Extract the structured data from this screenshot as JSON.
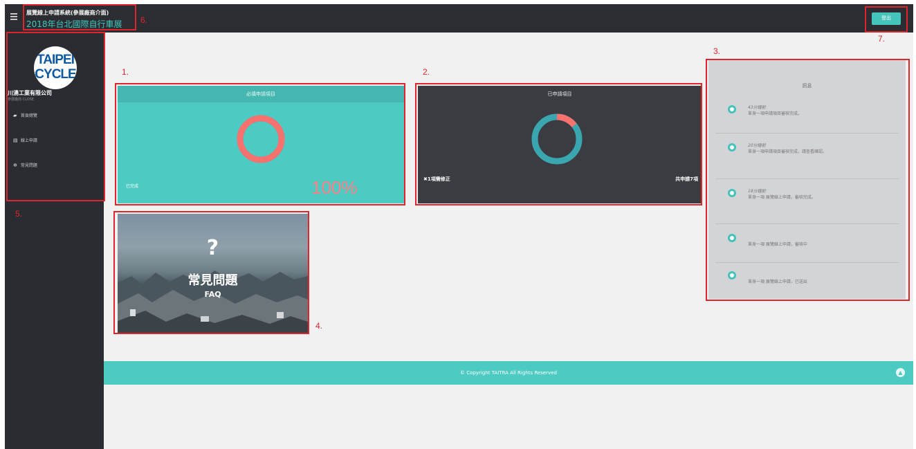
{
  "header": {
    "app_title": "展覽線上申請系統(參展廠商介面)",
    "exhibition": "2018年台北國際自行車展",
    "logout_label": "登出"
  },
  "sidebar": {
    "logo_line1": "TAIPEI",
    "logo_line2": "CYCLE",
    "company": "川湧工業有限公司",
    "company_sub": "參展廠商 CLOSE",
    "items": [
      {
        "label": "首頁總覽",
        "icon": "dashboard-icon"
      },
      {
        "label": "線上申請",
        "icon": "form-icon"
      },
      {
        "label": "常見問題",
        "icon": "gear-icon"
      }
    ]
  },
  "cards": {
    "required": {
      "title": "必填申請項目",
      "status": "已完成",
      "percent": "100%",
      "progress_fraction": 1.0
    },
    "applied": {
      "title": "已申請項目",
      "pending": "✖1項需修正",
      "total": "共申請7項",
      "needs_fix_fraction": 0.143
    },
    "faq": {
      "symbol": "?",
      "title": "常見問題",
      "subtitle": "FAQ"
    }
  },
  "notifications": {
    "title": "訊息",
    "items": [
      {
        "time": "43分鐘前",
        "text": "單身一項申請項目審核完成。"
      },
      {
        "time": "20分鐘前",
        "text": "單身一項申請項目審核完成，請查看確認。"
      },
      {
        "time": "18分鐘前",
        "text": "單身一項 展覽線上申請，審核完成。"
      },
      {
        "time": "",
        "text": "單身一項 展覽線上申請，審核中"
      },
      {
        "time": "",
        "text": "單身一項 展覽線上申請，已送出"
      }
    ]
  },
  "annotations": [
    "1.",
    "2.",
    "3.",
    "4.",
    "5.",
    "6.",
    "7."
  ],
  "footer": {
    "copyright": "© Copyright TAITRA All Rights Reserved"
  },
  "colors": {
    "teal": "#4dcbc2",
    "dark": "#2a2c31",
    "salmon": "#f7716f",
    "annotation_red": "#e0242c"
  }
}
